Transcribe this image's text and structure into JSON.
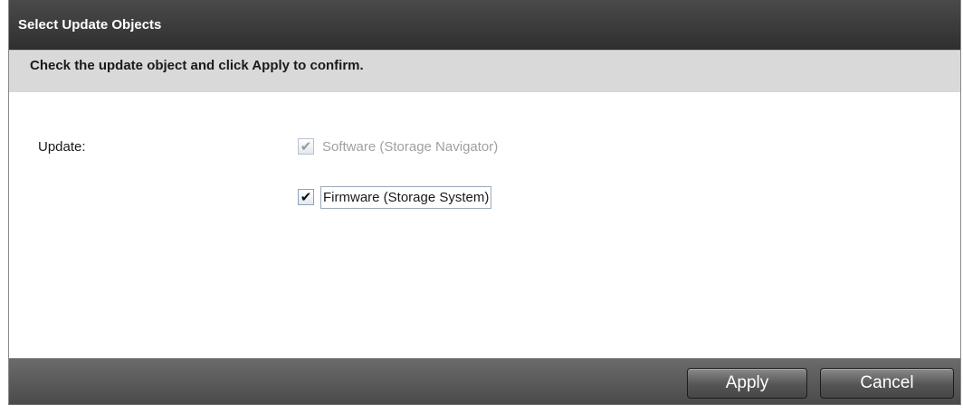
{
  "dialog": {
    "title": "Select Update Objects",
    "instruction": "Check the update object and click Apply to confirm."
  },
  "form": {
    "update_label": "Update:",
    "options": [
      {
        "label": "Software (Storage Navigator)",
        "checked": true,
        "enabled": false
      },
      {
        "label": "Firmware (Storage System)",
        "checked": true,
        "enabled": true
      }
    ],
    "check_glyph": "✔"
  },
  "footer": {
    "apply_label": "Apply",
    "cancel_label": "Cancel"
  }
}
